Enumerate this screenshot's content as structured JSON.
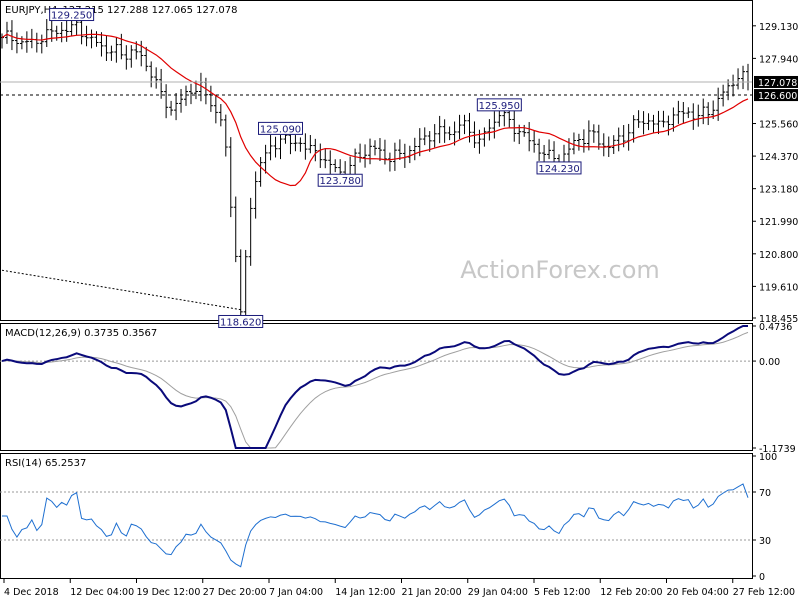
{
  "chart_data": [
    {
      "type": "candlestick",
      "symbol": "EURJPY,H4",
      "ohlc_label": "127.215 127.288 127.065 127.078",
      "current_price": "127.078",
      "level_line": "126.600",
      "ylim": [
        118.455,
        130.0
      ],
      "y_ticks": [
        "129.130",
        "127.940",
        "126.600",
        "125.560",
        "124.370",
        "123.180",
        "121.990",
        "120.800",
        "119.610",
        "118.455"
      ],
      "x_ticks": [
        "4 Dec 2018",
        "12 Dec 04:00",
        "19 Dec 12:00",
        "27 Dec 20:00",
        "7 Jan 04:00",
        "14 Jan 12:00",
        "21 Jan 20:00",
        "29 Jan 04:00",
        "5 Feb 12:00",
        "12 Feb 20:00",
        "20 Feb 04:00",
        "27 Feb 12:00"
      ],
      "price_path": [
        [
          0,
          128.7
        ],
        [
          3,
          128.6
        ],
        [
          6,
          128.5
        ],
        [
          9,
          128.8
        ],
        [
          12,
          129.0
        ],
        [
          15,
          129.1
        ],
        [
          16,
          128.9
        ],
        [
          18,
          128.6
        ],
        [
          20,
          128.4
        ],
        [
          22,
          128.2
        ],
        [
          24,
          128.1
        ],
        [
          26,
          128.2
        ],
        [
          28,
          128.0
        ],
        [
          30,
          127.4
        ],
        [
          32,
          126.6
        ],
        [
          34,
          126.1
        ],
        [
          36,
          126.4
        ],
        [
          38,
          126.8
        ],
        [
          40,
          126.9
        ],
        [
          42,
          126.3
        ],
        [
          44,
          125.7
        ],
        [
          45,
          124.5
        ],
        [
          46,
          122.5
        ],
        [
          47,
          121.0
        ],
        [
          48,
          118.62
        ],
        [
          49,
          120.5
        ],
        [
          50,
          122.5
        ],
        [
          51,
          123.5
        ],
        [
          52,
          124.2
        ],
        [
          54,
          124.6
        ],
        [
          56,
          125.09
        ],
        [
          58,
          124.8
        ],
        [
          60,
          124.9
        ],
        [
          62,
          124.6
        ],
        [
          64,
          124.4
        ],
        [
          66,
          124.0
        ],
        [
          68,
          123.78
        ],
        [
          70,
          124.0
        ],
        [
          72,
          124.4
        ],
        [
          74,
          124.7
        ],
        [
          76,
          124.5
        ],
        [
          78,
          124.3
        ],
        [
          80,
          124.4
        ],
        [
          82,
          124.6
        ],
        [
          84,
          124.9
        ],
        [
          86,
          125.1
        ],
        [
          88,
          125.3
        ],
        [
          90,
          125.2
        ],
        [
          92,
          125.5
        ],
        [
          94,
          125.3
        ],
        [
          96,
          124.9
        ],
        [
          98,
          125.4
        ],
        [
          100,
          125.95
        ],
        [
          102,
          125.6
        ],
        [
          104,
          125.3
        ],
        [
          106,
          124.9
        ],
        [
          108,
          124.6
        ],
        [
          110,
          124.4
        ],
        [
          112,
          124.23
        ],
        [
          114,
          124.6
        ],
        [
          116,
          125.0
        ],
        [
          118,
          125.2
        ],
        [
          120,
          124.9
        ],
        [
          122,
          124.7
        ],
        [
          124,
          125.0
        ],
        [
          126,
          125.3
        ],
        [
          128,
          125.6
        ],
        [
          130,
          125.7
        ],
        [
          132,
          125.5
        ],
        [
          134,
          125.7
        ],
        [
          136,
          125.9
        ],
        [
          138,
          126.0
        ],
        [
          140,
          125.8
        ],
        [
          142,
          126.0
        ],
        [
          144,
          126.4
        ],
        [
          146,
          126.9
        ],
        [
          148,
          127.3
        ],
        [
          150,
          127.078
        ]
      ],
      "annotations": [
        {
          "label": "129.250",
          "i": 14,
          "y": 129.25
        },
        {
          "label": "125.090",
          "i": 56,
          "y": 125.09
        },
        {
          "label": "123.780",
          "i": 68,
          "y": 123.78
        },
        {
          "label": "125.950",
          "i": 100,
          "y": 125.95
        },
        {
          "label": "124.230",
          "i": 112,
          "y": 124.23
        },
        {
          "label": "118.620",
          "i": 48,
          "y": 118.62
        }
      ]
    },
    {
      "type": "line",
      "title": "MACD(12,26,9) 0.3735 0.3567",
      "ylim": [
        -1.1739,
        0.4736
      ],
      "y_ticks": [
        "0.4736",
        "0.00",
        "-1.1739"
      ]
    },
    {
      "type": "line",
      "title": "RSI(14) 65.2537",
      "ylim": [
        0,
        100
      ],
      "y_ticks": [
        "100",
        "70",
        "30",
        "0"
      ],
      "levels": [
        70,
        30
      ]
    }
  ],
  "watermark": "ActionForex.com"
}
